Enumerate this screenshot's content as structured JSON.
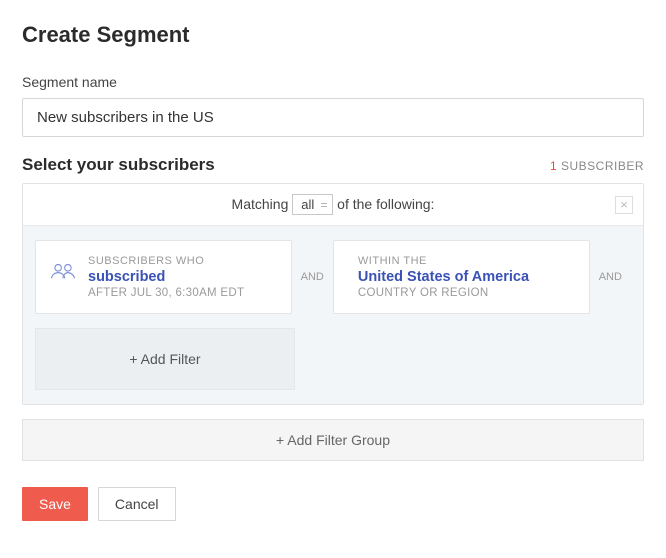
{
  "page_title": "Create Segment",
  "segment_name": {
    "label": "Segment name",
    "value": "New subscribers in the US"
  },
  "subscribers_header": "Select your subscribers",
  "subscriber_count": {
    "num": "1",
    "label": "SUBSCRIBER"
  },
  "match": {
    "prefix": "Matching",
    "mode": "all",
    "suffix": "of the following:"
  },
  "filters": [
    {
      "kicker": "SUBSCRIBERS WHO",
      "main": "subscribed",
      "sub": "AFTER JUL 30, 6:30AM EDT"
    },
    {
      "kicker": "WITHIN THE",
      "main": "United States of America",
      "sub": "COUNTRY OR REGION"
    }
  ],
  "joiner": "AND",
  "add_filter_label": "+ Add Filter",
  "add_group_label": "+ Add Filter Group",
  "actions": {
    "save": "Save",
    "cancel": "Cancel"
  }
}
